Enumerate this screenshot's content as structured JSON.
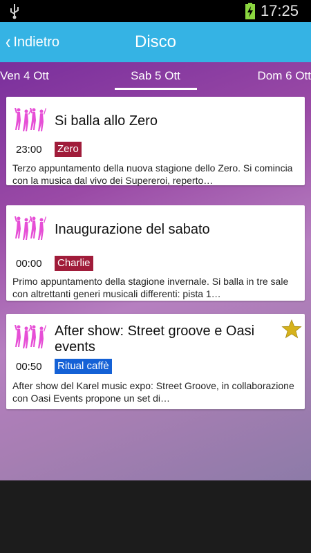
{
  "status_bar": {
    "time": "17:25"
  },
  "action_bar": {
    "back_label": "Indietro",
    "title": "Disco"
  },
  "tabs": {
    "prev": "Ven 4 Ott",
    "current": "Sab 5 Ott",
    "next": "Dom 6 Ott"
  },
  "colors": {
    "accent": "#35b3e4",
    "venue_red": "#a01c3a",
    "venue_blue": "#1461d6",
    "star": "#d6b21c"
  },
  "events": [
    {
      "title": "Si balla allo Zero",
      "time": "23:00",
      "venue": "Zero",
      "description": "Terzo appuntamento della nuova stagione dello Zero. Si comincia con la musica dal vivo dei Supereroi, reperto…",
      "favorite": false
    },
    {
      "title": "Inaugurazione del sabato",
      "time": "00:00",
      "venue": "Charlie",
      "description": "Primo appuntamento della stagione invernale. Si balla in tre sale con altrettanti generi musicali differenti: pista 1…",
      "favorite": false
    },
    {
      "title": "After show: Street groove e Oasi events",
      "time": "00:50",
      "venue": "Ritual caffè",
      "description": "After show del Karel music expo: Street Groove, in collaborazione con Oasi Events propone un set di…",
      "favorite": true
    }
  ]
}
